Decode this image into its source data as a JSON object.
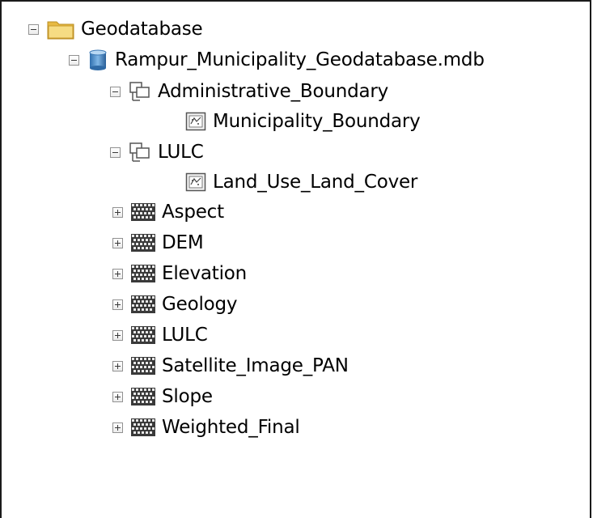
{
  "tree": {
    "root": {
      "label": "Geodatabase",
      "icon": "folder-icon",
      "state": "expanded"
    },
    "database": {
      "label": "Rampur_Municipality_Geodatabase.mdb",
      "icon": "database-icon",
      "state": "expanded"
    },
    "datasets": [
      {
        "label": "Administrative_Boundary",
        "icon": "feature-dataset-icon",
        "state": "expanded",
        "children": [
          {
            "label": "Municipality_Boundary",
            "icon": "polygon-feature-class-icon"
          }
        ]
      },
      {
        "label": "LULC",
        "icon": "feature-dataset-icon",
        "state": "expanded",
        "children": [
          {
            "label": "Land_Use_Land_Cover",
            "icon": "polygon-feature-class-icon"
          }
        ]
      }
    ],
    "rasters": [
      {
        "label": "Aspect",
        "icon": "raster-dataset-icon",
        "state": "collapsed"
      },
      {
        "label": "DEM",
        "icon": "raster-dataset-icon",
        "state": "collapsed"
      },
      {
        "label": "Elevation",
        "icon": "raster-dataset-icon",
        "state": "collapsed"
      },
      {
        "label": "Geology",
        "icon": "raster-dataset-icon",
        "state": "collapsed"
      },
      {
        "label": "LULC",
        "icon": "raster-dataset-icon",
        "state": "collapsed"
      },
      {
        "label": "Satellite_Image_PAN",
        "icon": "raster-dataset-icon",
        "state": "collapsed"
      },
      {
        "label": "Slope",
        "icon": "raster-dataset-icon",
        "state": "collapsed"
      },
      {
        "label": "Weighted_Final",
        "icon": "raster-dataset-icon",
        "state": "collapsed"
      }
    ]
  },
  "colors": {
    "border": "#1a1a1a",
    "folder": "#f2d06b",
    "database": "#4d8fc8"
  }
}
